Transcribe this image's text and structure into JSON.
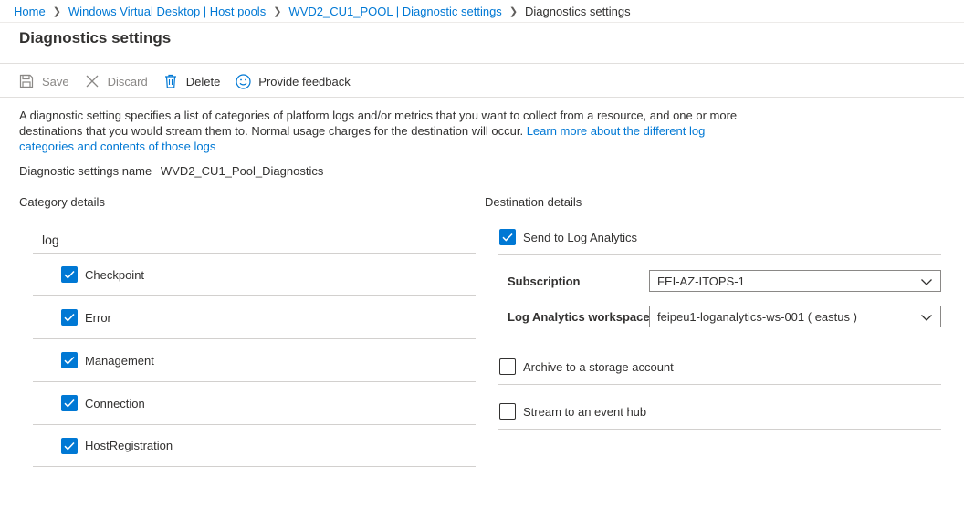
{
  "breadcrumb": {
    "items": [
      "Home",
      "Windows Virtual Desktop | Host pools",
      "WVD2_CU1_POOL | Diagnostic settings"
    ],
    "current": "Diagnostics settings"
  },
  "page": {
    "title": "Diagnostics settings"
  },
  "toolbar": {
    "save_label": "Save",
    "discard_label": "Discard",
    "delete_label": "Delete",
    "feedback_label": "Provide feedback"
  },
  "description": {
    "text": "A diagnostic setting specifies a list of categories of platform logs and/or metrics that you want to collect from a resource, and one or more destinations that you would stream them to. Normal usage charges for the destination will occur. ",
    "link": "Learn more about the different log categories and contents of those logs"
  },
  "setting_name": {
    "label": "Diagnostic settings name",
    "value": "WVD2_CU1_Pool_Diagnostics"
  },
  "category": {
    "title": "Category details",
    "log_header": "log",
    "items": [
      {
        "label": "Checkpoint",
        "checked": true
      },
      {
        "label": "Error",
        "checked": true
      },
      {
        "label": "Management",
        "checked": true
      },
      {
        "label": "Connection",
        "checked": true
      },
      {
        "label": "HostRegistration",
        "checked": true
      }
    ]
  },
  "destination": {
    "title": "Destination details",
    "log_analytics": {
      "label": "Send to Log Analytics",
      "checked": true
    },
    "subscription": {
      "label": "Subscription",
      "value": "FEI-AZ-ITOPS-1"
    },
    "workspace": {
      "label": "Log Analytics workspace",
      "value": "feipeu1-loganalytics-ws-001 ( eastus )"
    },
    "storage": {
      "label": "Archive to a storage account",
      "checked": false
    },
    "event_hub": {
      "label": "Stream to an event hub",
      "checked": false
    }
  },
  "colors": {
    "accent": "#0078d4",
    "text": "#323130",
    "disabled": "#8a8886",
    "divider": "#d2d0ce"
  },
  "icons": {
    "save": "save-icon",
    "discard": "close-icon",
    "delete": "trash-icon",
    "feedback": "smiley-icon",
    "checkbox": "checkmark-icon",
    "dropdown": "chevron-down-icon"
  }
}
